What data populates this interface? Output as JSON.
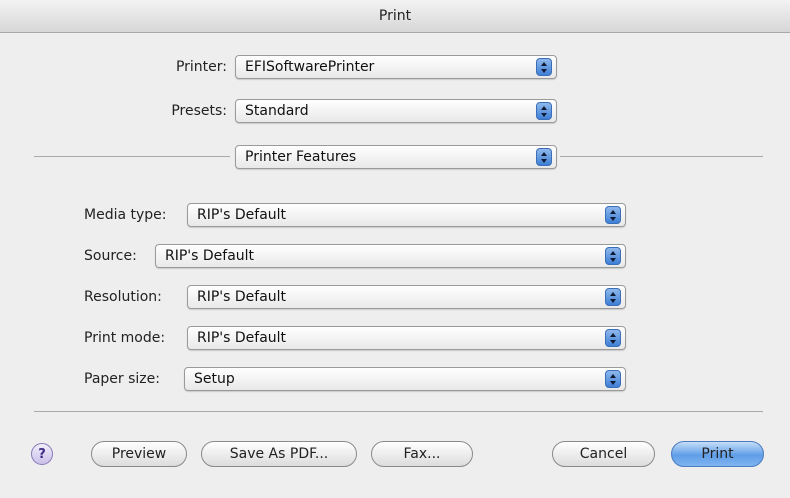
{
  "window": {
    "title": "Print"
  },
  "printer": {
    "label": "Printer:",
    "value": "EFISoftwarePrinter"
  },
  "presets": {
    "label": "Presets:",
    "value": "Standard"
  },
  "panel_selector": {
    "value": "Printer Features"
  },
  "features": [
    {
      "label": "Media type:",
      "value": "RIP's Default"
    },
    {
      "label": "Source:",
      "value": "RIP's Default"
    },
    {
      "label": "Resolution:",
      "value": "RIP's Default"
    },
    {
      "label": "Print mode:",
      "value": "RIP's Default"
    },
    {
      "label": "Paper size:",
      "value": "Setup"
    }
  ],
  "buttons": {
    "help": "?",
    "preview": "Preview",
    "save_pdf": "Save As PDF...",
    "fax": "Fax...",
    "cancel": "Cancel",
    "print": "Print"
  }
}
